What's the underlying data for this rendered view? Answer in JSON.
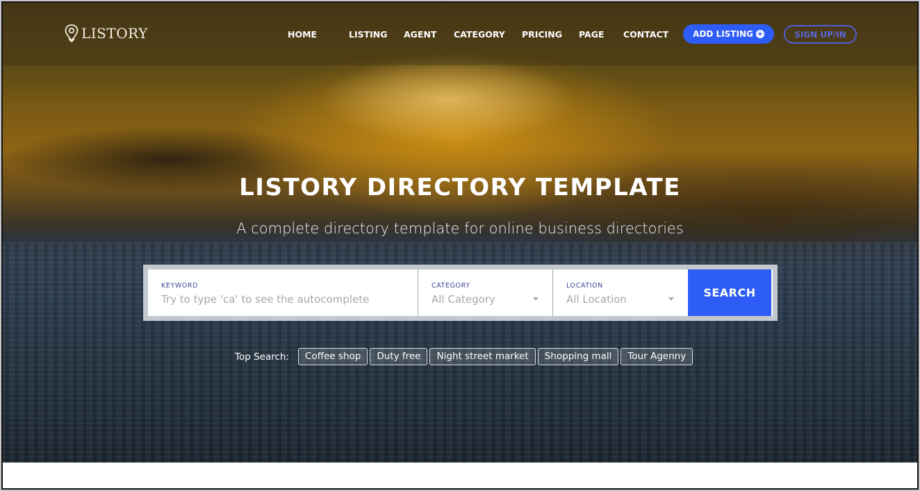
{
  "brand": {
    "logo_text": "LISTORY",
    "logo_icon": "map-pin-icon"
  },
  "nav": {
    "items": [
      {
        "label": "HOME"
      },
      {
        "label": "LISTING"
      },
      {
        "label": "AGENT"
      },
      {
        "label": "CATEGORY"
      },
      {
        "label": "PRICING"
      },
      {
        "label": "PAGE"
      },
      {
        "label": "CONTACT"
      }
    ],
    "add_listing_label": "ADD LISTING",
    "add_listing_icon": "plus-circle-icon",
    "signup_label": "SIGN UP/IN"
  },
  "hero": {
    "title": "LISTORY DIRECTORY TEMPLATE",
    "subtitle": "A complete directory template for online business directories"
  },
  "search": {
    "keyword_label": "KEYWORD",
    "keyword_placeholder": "Try to type 'ca' to see the autocomplete",
    "category_label": "CATEGORY",
    "category_value": "All Category",
    "location_label": "LOCATION",
    "location_value": "All Location",
    "button_label": "SEARCH"
  },
  "top_search": {
    "label": "Top Search:",
    "tags": [
      "Coffee shop",
      "Duty free",
      "Night street market",
      "Shopping mall",
      "Tour Agenny"
    ]
  },
  "colors": {
    "accent": "#2d5cf6",
    "label_text": "#3d4596",
    "signup_outline": "#4f5fd8"
  }
}
